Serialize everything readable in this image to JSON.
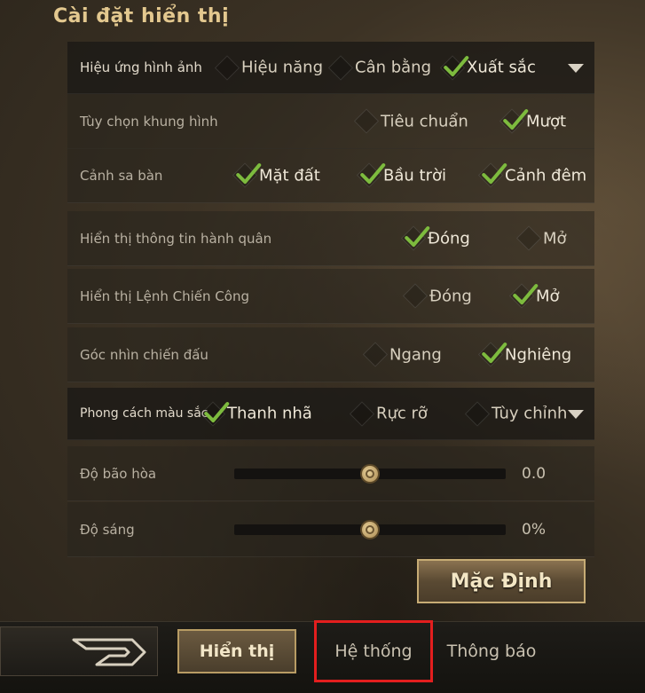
{
  "title": "Cài đặt hiển thị",
  "rows": {
    "image_effect": {
      "label": "Hiệu ứng hình ảnh",
      "options": [
        "Hiệu năng",
        "Cân bằng",
        "Xuất sắc"
      ],
      "selected": "Xuất sắc"
    },
    "frame_option": {
      "label": "Tùy chọn khung hình",
      "options": [
        "Tiêu chuẩn",
        "Mượt"
      ],
      "selected": "Mượt"
    },
    "sandbox_scene": {
      "label": "Cảnh sa bàn",
      "options": [
        "Mặt đất",
        "Bầu trời",
        "Cảnh đêm"
      ],
      "selected": [
        "Mặt đất",
        "Bầu trời",
        "Cảnh đêm"
      ]
    },
    "march_info": {
      "label": "Hiển thị thông tin hành quân",
      "options": [
        "Đóng",
        "Mở"
      ],
      "selected": "Đóng"
    },
    "battle_order": {
      "label": "Hiển thị Lệnh Chiến Công",
      "options": [
        "Đóng",
        "Mở"
      ],
      "selected": "Mở"
    },
    "combat_view": {
      "label": "Góc nhìn chiến đấu",
      "options": [
        "Ngang",
        "Nghiêng"
      ],
      "selected": "Nghiêng"
    },
    "color_style": {
      "label": "Phong cách màu sắc",
      "options": [
        "Thanh nhã",
        "Rực rỡ",
        "Tùy chỉnh"
      ],
      "selected": "Thanh nhã"
    }
  },
  "sliders": {
    "saturation": {
      "label": "Độ bão hòa",
      "value_text": "0.0",
      "fraction": 0.5
    },
    "brightness": {
      "label": "Độ sáng",
      "value_text": "0%",
      "fraction": 0.5
    }
  },
  "default_button": "Mặc Định",
  "tabs": {
    "display": "Hiển thị",
    "system": "Hệ thống",
    "notification": "Thông báo"
  },
  "active_tab": "Hiển thị",
  "colors": {
    "accent_gold": "#e3c88f",
    "check_green": "#7dbb3e",
    "highlight_red": "#e31e1e"
  }
}
